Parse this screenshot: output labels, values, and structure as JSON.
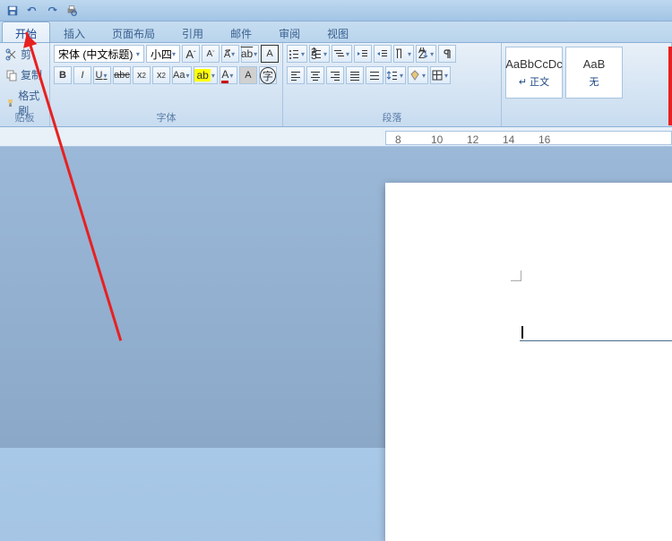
{
  "qat": {
    "save": "保存",
    "undo": "撤销",
    "redo": "重做",
    "preview": "打印预览"
  },
  "tabs": [
    "开始",
    "插入",
    "页面布局",
    "引用",
    "邮件",
    "审阅",
    "视图"
  ],
  "active_tab": 0,
  "clipboard": {
    "cut": "剪",
    "copy": "复制",
    "format": "格式刷",
    "label": "贴板"
  },
  "font": {
    "name": "宋体 (中文标题)",
    "size": "小四",
    "label": "字体",
    "bold": "B",
    "italic": "I",
    "underline": "U",
    "strike": "abc",
    "sub": "x₂",
    "sup": "x²",
    "case": "Aa",
    "grow": "A",
    "shrink": "A",
    "clear": "A",
    "highlight": "ab",
    "color": "A",
    "enclose": "字",
    "border": "A"
  },
  "para": {
    "label": "段落"
  },
  "styles": {
    "items": [
      {
        "preview": "AaBbCcDc",
        "name": "↵ 正文"
      },
      {
        "preview": "AaB",
        "name": "无"
      }
    ]
  },
  "ruler": {
    "marks": [
      "8",
      "10",
      "12",
      "14",
      "16"
    ]
  },
  "colors": {
    "accent": "#2a5a9a",
    "highlight": "#ffff00",
    "fontcolor": "#cc0000"
  }
}
